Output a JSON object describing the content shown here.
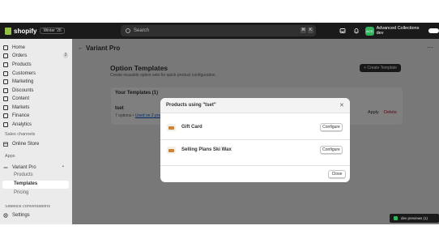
{
  "topbar": {
    "brand": "shopify",
    "edition": "Winter '26",
    "search_placeholder": "Search",
    "shortcut_keys": [
      "⌘",
      "K"
    ],
    "store_initials": "ACD",
    "store_name": "Advanced Collections dev"
  },
  "sidebar": {
    "items": [
      {
        "label": "Home",
        "icon": "home-icon"
      },
      {
        "label": "Orders",
        "icon": "orders-icon",
        "badge": "3"
      },
      {
        "label": "Products",
        "icon": "products-icon"
      },
      {
        "label": "Customers",
        "icon": "customers-icon"
      },
      {
        "label": "Marketing",
        "icon": "marketing-icon"
      },
      {
        "label": "Discounts",
        "icon": "discounts-icon"
      },
      {
        "label": "Content",
        "icon": "content-icon"
      },
      {
        "label": "Markets",
        "icon": "markets-icon"
      },
      {
        "label": "Finance",
        "icon": "finance-icon"
      },
      {
        "label": "Analytics",
        "icon": "analytics-icon"
      }
    ],
    "sales_channels_label": "Sales channels",
    "online_store": "Online Store",
    "apps_label": "Apps",
    "app_name": "Variant Pro",
    "app_subitems": [
      "Products",
      "Templates",
      "Pricing"
    ],
    "active_subitem": "Templates",
    "pinned_label": "Sidekick conversations",
    "settings": "Settings"
  },
  "page": {
    "title": "Variant Pro",
    "heading": "Option Templates",
    "subheading": "Create reusable option sets for quick product configuration.",
    "create_button": "Create Template",
    "card_title": "Your Templates (1)",
    "template_name": "tset",
    "template_meta": "7 options",
    "template_link": "Used on 2 products",
    "apply_label": "Apply",
    "delete_label": "Delete"
  },
  "modal": {
    "title": "Products using \"tset\"",
    "products": [
      {
        "name": "Gift Card",
        "action": "Configure"
      },
      {
        "name": "Selling Plans Ski Wax",
        "action": "Configure"
      }
    ],
    "close_label": "Close"
  },
  "devbar": {
    "label": "dev previews",
    "count": "(1)"
  }
}
